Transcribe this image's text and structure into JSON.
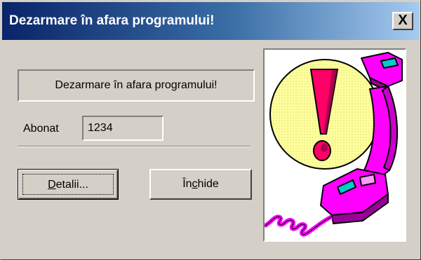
{
  "window": {
    "title": "Dezarmare în afara programului!",
    "close_label": "X"
  },
  "message": "Dezarmare în afara programului!",
  "abonat": {
    "label": "Abonat",
    "value": "1234"
  },
  "buttons": {
    "details": {
      "accel": "D",
      "rest": "etalii..."
    },
    "close": {
      "before": "În",
      "accel": "c",
      "after": "hide"
    }
  },
  "picture": {
    "icon": "alarm-phone-warning-icon",
    "colors": {
      "circle": "#ffff99",
      "exclamation": "#ff0066",
      "phone": "#ff00ff",
      "outline": "#000000"
    }
  }
}
